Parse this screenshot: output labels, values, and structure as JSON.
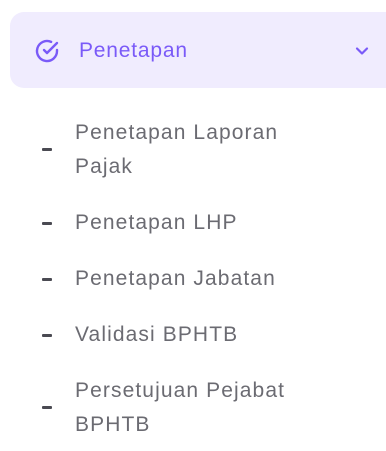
{
  "menu": {
    "title": "Penetapan",
    "icon": "check-circle-icon",
    "chevron_icon": "chevron-down-icon",
    "accent_color": "#7a5af8",
    "header_bg": "#f0ecfe",
    "items": [
      {
        "label": "Penetapan Laporan Pajak"
      },
      {
        "label": "Penetapan LHP"
      },
      {
        "label": "Penetapan Jabatan"
      },
      {
        "label": "Validasi BPHTB"
      },
      {
        "label": "Persetujuan Pejabat BPHTB"
      }
    ]
  }
}
